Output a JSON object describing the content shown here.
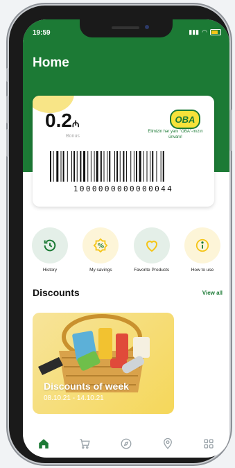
{
  "status": {
    "time": "19:59"
  },
  "header": {
    "title": "Home"
  },
  "card": {
    "bonus_value": "0.2",
    "bonus_currency": "₼",
    "bonus_label": "Bonus",
    "logo_text": "OBA",
    "slogan": "Elimizin hər yanı \"OBA\"-mızın ünvanı!",
    "barcode_number": "1000000000000044"
  },
  "actions": [
    {
      "label": "History",
      "icon": "history-icon",
      "bg": "#e4efe8"
    },
    {
      "label": "My savings",
      "icon": "percent-icon",
      "bg": "#fdf5d8"
    },
    {
      "label": "Favorite Products",
      "icon": "heart-icon",
      "bg": "#e4efe8"
    },
    {
      "label": "How to use",
      "icon": "info-icon",
      "bg": "#fdf5d8"
    }
  ],
  "discounts": {
    "title": "Discounts",
    "view_all": "View all",
    "promo_title": "Discounts of week",
    "promo_date": "08.10.21 - 14.10.21"
  },
  "tabbar": [
    "home-icon",
    "cart-icon",
    "compass-icon",
    "location-icon",
    "grid-icon"
  ],
  "colors": {
    "brand": "#1c7a35",
    "accent": "#f7e23a"
  }
}
